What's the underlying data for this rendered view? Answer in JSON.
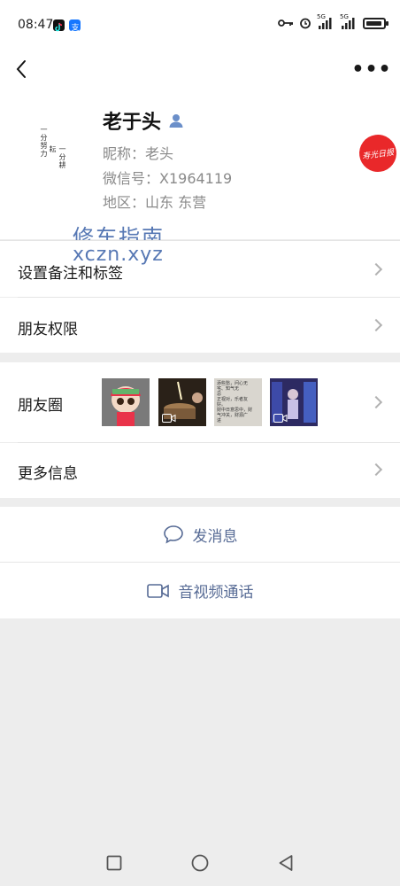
{
  "status_bar": {
    "time": "08:47",
    "net1": "5G",
    "net2": "5G",
    "icons": [
      "tiktok-icon",
      "alipay-icon",
      "key-icon",
      "alarm-icon",
      "signal-icon",
      "signal-icon",
      "battery-icon"
    ]
  },
  "nav": {
    "back_icon": "chevron-left-icon",
    "more_label": "•••"
  },
  "profile": {
    "name": "老于头",
    "nickname": "昵称：老头",
    "wechat_id": "微信号：X1964119",
    "region": "地区：山东  东营",
    "avatar_text_1": "一分耕耘",
    "avatar_text_2": "一分努力",
    "stamp_text": "寿光日报"
  },
  "watermark": {
    "line1": "修车指南",
    "line2": "xczn.xyz"
  },
  "menu": {
    "remarks": "设置备注和标签",
    "permissions": "朋友权限",
    "moments": "朋友圈",
    "more_info": "更多信息"
  },
  "moments_thumbs": [
    {
      "name": "doll-photo",
      "has_video": false
    },
    {
      "name": "birthday-cake-video",
      "has_video": true
    },
    {
      "name": "text-note-photo",
      "has_video": false,
      "text": "添些愁，问心无\n宅、知气无\n忌\n正视对，乐者友\n好。\n财中日意思中，财\n气冲关，财源广\n进"
    },
    {
      "name": "party-video",
      "has_video": true
    }
  ],
  "actions": {
    "message": "发消息",
    "call": "音视频通话"
  },
  "colors": {
    "link": "#576b95",
    "stamp_red": "#e9282a",
    "watermark_blue": "#3a61a8",
    "bg": "#ededed"
  }
}
